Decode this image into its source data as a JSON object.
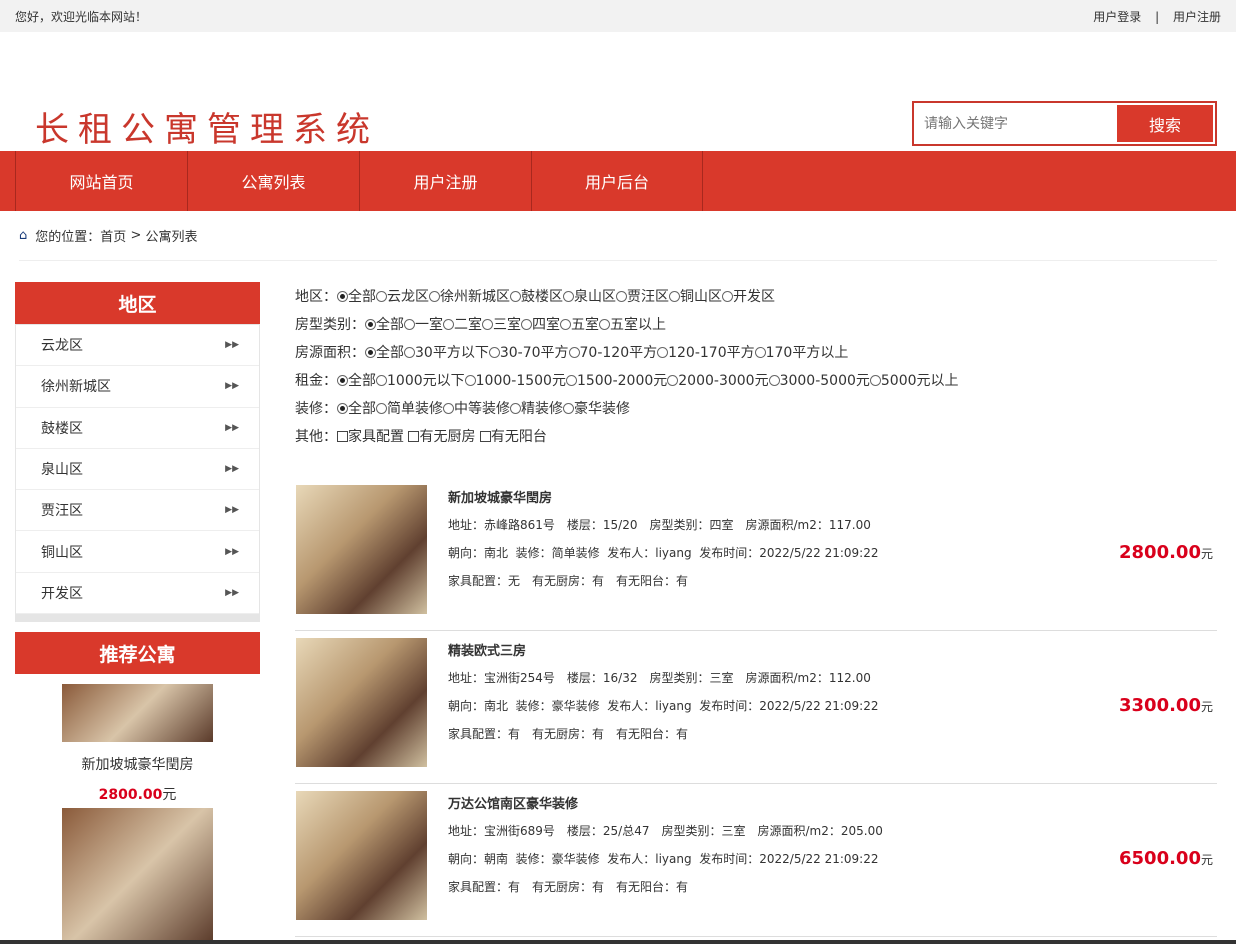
{
  "topbar": {
    "welcome": "您好，欢迎光临本网站！",
    "login": "用户登录",
    "sep": "|",
    "register": "用户注册"
  },
  "header": {
    "title": "长租公寓管理系统",
    "search_placeholder": "请输入关键字",
    "search_button": "搜索"
  },
  "nav": [
    "网站首页",
    "公寓列表",
    "用户注册",
    "用户后台"
  ],
  "breadcrumb": {
    "label": "您的位置：",
    "home": "首页",
    "sep": ">",
    "current": "公寓列表"
  },
  "sidebar": {
    "title": "地区",
    "items": [
      "云龙区",
      "徐州新城区",
      "鼓楼区",
      "泉山区",
      "贾汪区",
      "铜山区",
      "开发区"
    ],
    "rec_title": "推荐公寓",
    "rec": [
      {
        "name": "新加坡城豪华閏房",
        "price": "2800.00",
        "unit": "元"
      }
    ]
  },
  "filters": [
    {
      "label": "地区：",
      "options": [
        "全部",
        "云龙区",
        "徐州新城区",
        "鼓楼区",
        "泉山区",
        "贾汪区",
        "铜山区",
        "开发区"
      ]
    },
    {
      "label": "房型类别：",
      "options": [
        "全部",
        "一室",
        "二室",
        "三室",
        "四室",
        "五室",
        "五室以上"
      ]
    },
    {
      "label": "房源面积：",
      "options": [
        "全部",
        "30平方以下",
        "30-70平方",
        "70-120平方",
        "120-170平方",
        "170平方以上"
      ]
    },
    {
      "label": "租金：",
      "options": [
        "全部",
        "1000元以下",
        "1000-1500元",
        "1500-2000元",
        "2000-3000元",
        "3000-5000元",
        "5000元以上"
      ]
    },
    {
      "label": "装修：",
      "options": [
        "全部",
        "简单装修",
        "中等装修",
        "精装修",
        "豪华装修"
      ]
    }
  ],
  "other": {
    "label": "其他：",
    "options": [
      "家具配置",
      "有无厨房",
      "有无阳台"
    ]
  },
  "listings": [
    {
      "title": "新加坡城豪华閏房",
      "line1": "地址：赤峰路861号　楼层：15/20　房型类别：四室　房源面积/m2：117.00",
      "line2": "朝向：南北  装修：简单装修  发布人：liyang  发布时间：2022/5/22 21:09:22",
      "line3": "家具配置：无　有无厨房：有　有无阳台：有",
      "price": "2800.00",
      "unit": "元"
    },
    {
      "title": "精装欧式三房",
      "line1": "地址：宝洲街254号　楼层：16/32　房型类别：三室　房源面积/m2：112.00",
      "line2": "朝向：南北  装修：豪华装修  发布人：liyang  发布时间：2022/5/22 21:09:22",
      "line3": "家具配置：有　有无厨房：有　有无阳台：有",
      "price": "3300.00",
      "unit": "元"
    },
    {
      "title": "万达公馆南区豪华装修",
      "line1": "地址：宝洲街689号　楼层：25/总47　房型类别：三室　房源面积/m2：205.00",
      "line2": "朝向：朝南  装修：豪华装修  发布人：liyang  发布时间：2022/5/22 21:09:22",
      "line3": "家具配置：有　有无厨房：有　有无阳台：有",
      "price": "6500.00",
      "unit": "元"
    }
  ]
}
